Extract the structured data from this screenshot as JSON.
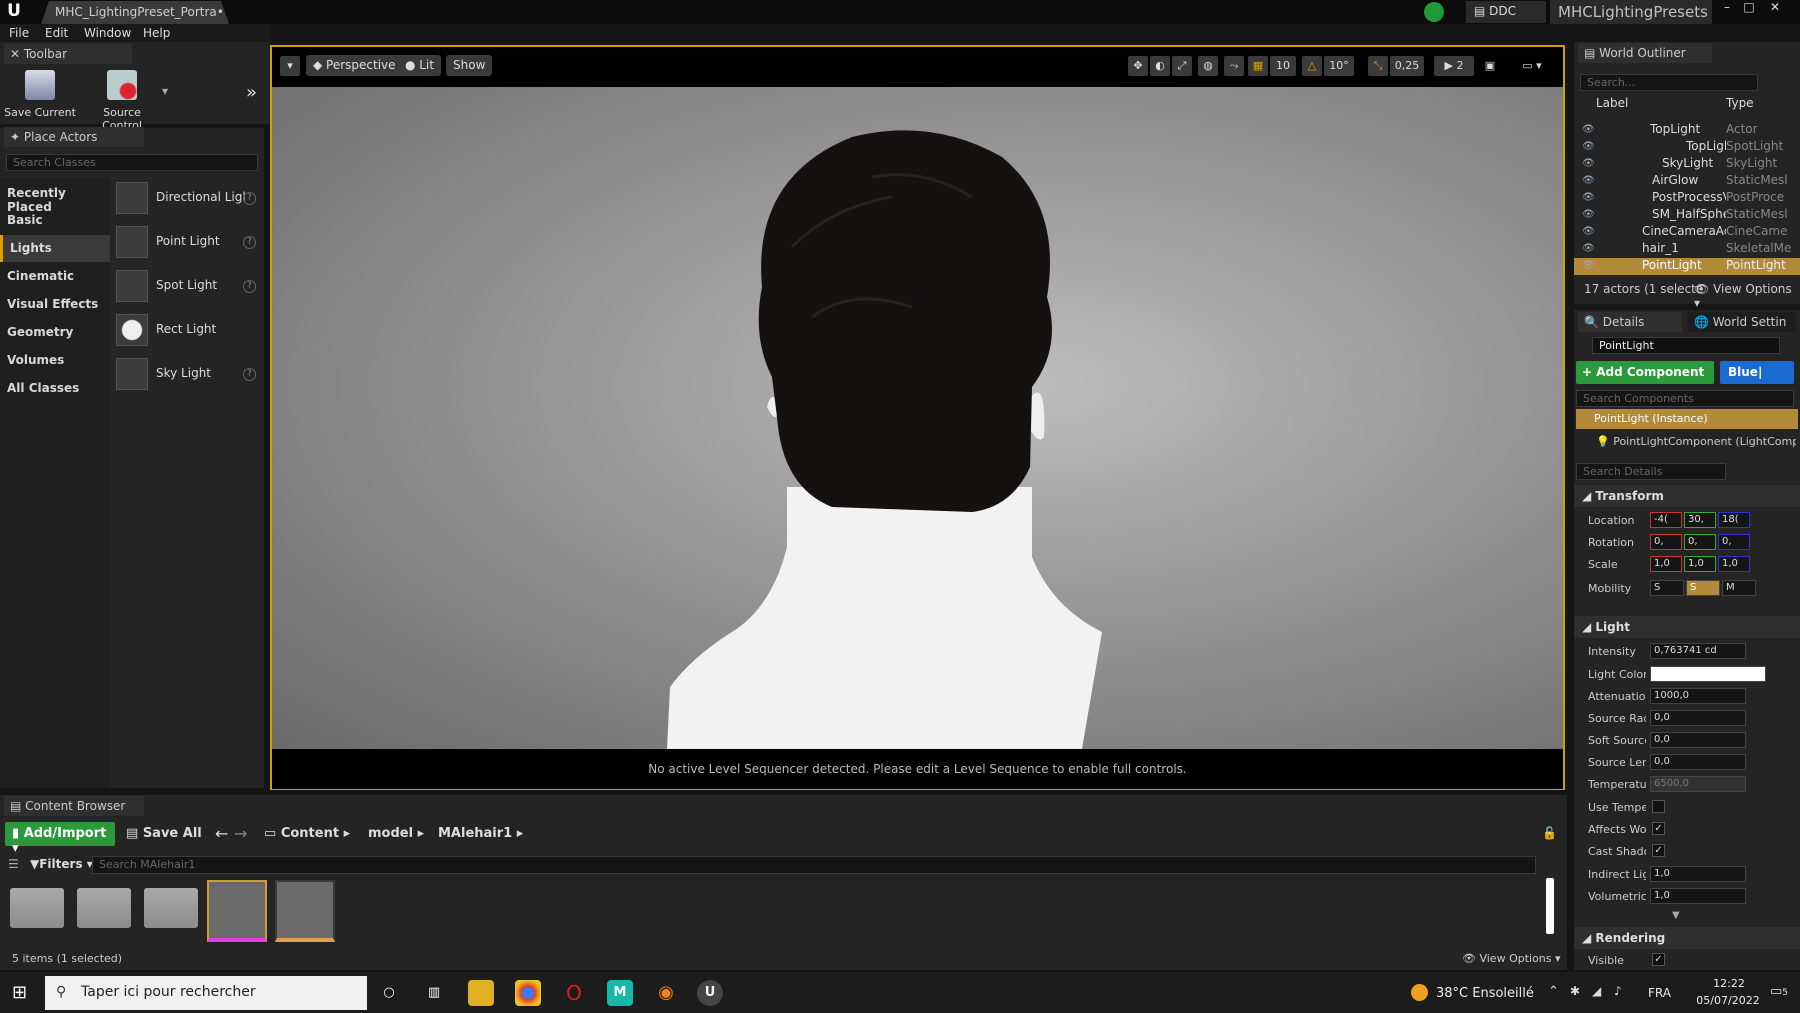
{
  "title_bar": {
    "doc_tab": "MHC_LightingPreset_Portra•",
    "ddc": "DDC",
    "project": "MHCLightingPresets",
    "window_buttons": [
      "–",
      "□",
      "✕"
    ]
  },
  "menu": [
    "File",
    "Edit",
    "Window",
    "Help"
  ],
  "toolbar": {
    "tab": "Toolbar",
    "save_current": "Save Current",
    "source_control": "Source Control"
  },
  "place_actors": {
    "tab": "Place Actors",
    "search_placeholder": "Search Classes",
    "categories": [
      "Recently Placed",
      "Basic",
      "Lights",
      "Cinematic",
      "Visual Effects",
      "Geometry",
      "Volumes",
      "All Classes"
    ],
    "active_category": "Lights",
    "items": [
      "Directional Ligl",
      "Point Light",
      "Spot Light",
      "Rect Light",
      "Sky Light"
    ]
  },
  "viewport": {
    "perspective": "Perspective",
    "lit": "Lit",
    "show": "Show",
    "grid_snap": "10",
    "rot_snap": "10°",
    "scale_snap": "0,25",
    "cam_speed": "2",
    "status": "No active Level Sequencer detected. Please edit a Level Sequence to enable full controls."
  },
  "outliner": {
    "tab": "World Outliner",
    "search_placeholder": "Search...",
    "col_label": "Label",
    "col_type": "Type",
    "rows": [
      {
        "label": "TopLight",
        "type": "Actor",
        "indent": 1
      },
      {
        "label": "TopLigl",
        "type": "SpotLight",
        "indent": 2
      },
      {
        "label": "SkyLight",
        "type": "SkyLight",
        "indent": 1
      },
      {
        "label": "AirGlow",
        "type": "StaticMesl",
        "indent": 0
      },
      {
        "label": "PostProcessV",
        "type": "PostProce",
        "indent": 0
      },
      {
        "label": "SM_HalfSpher",
        "type": "StaticMesl",
        "indent": 0
      },
      {
        "label": "CineCameraActc",
        "type": "CineCame",
        "indent": 0
      },
      {
        "label": "hair_1",
        "type": "SkeletalMe",
        "indent": 0
      },
      {
        "label": "PointLight",
        "type": "PointLight",
        "indent": 0
      }
    ],
    "footer": "17 actors (1 selecte",
    "view_options": "View Options"
  },
  "details": {
    "tab": "Details",
    "tab2": "World Settin",
    "name": "PointLight",
    "add_component": "+ Add Component",
    "blueprint": "Blue|",
    "search_components": "Search Components",
    "instance": "PointLight (Instance)",
    "component": "PointLightComponent (LightCompor",
    "search_details": "Search Details",
    "transform": {
      "title": "Transform",
      "location_label": "Location",
      "location": [
        "-4(",
        "30,",
        "18("
      ],
      "rotation_label": "Rotation",
      "rotation": [
        "0,",
        "0,",
        "0,"
      ],
      "scale_label": "Scale",
      "scale": [
        "1,0",
        "1,0",
        "1,0"
      ],
      "mobility_label": "Mobility",
      "mobility": [
        "S",
        "S",
        "M"
      ]
    },
    "light": {
      "title": "Light",
      "intensity_label": "Intensity",
      "intensity": "0,763741 cd",
      "color_label": "Light Color",
      "attenuation_label": "Attenuation",
      "attenuation": "1000,0",
      "source_radius_label": "Source Radi",
      "source_radius": "0,0",
      "soft_source_label": "Soft Source",
      "soft_source": "0,0",
      "source_length_label": "Source Leng",
      "source_length": "0,0",
      "temperature_label": "Temperatur",
      "temperature": "6500,0",
      "use_temp_label": "Use Temper",
      "affects_world_label": "Affects Worl",
      "cast_shadows_label": "Cast Shadov",
      "indirect_label": "Indirect Ligh",
      "indirect": "1,0",
      "volumetric_label": "Volumetric S",
      "volumetric": "1,0"
    },
    "rendering": {
      "title": "Rendering",
      "visible_label": "Visible"
    }
  },
  "content_browser": {
    "tab": "Content Browser",
    "add_import": "Add/Import",
    "save_all": "Save All",
    "path": [
      "Content",
      "model",
      "MAlehair1"
    ],
    "filters": "Filters",
    "search_placeholder": "Search MAlehair1",
    "status": "5 items (1 selected)",
    "view_options": "View Options"
  },
  "taskbar": {
    "search": "Taper ici pour rechercher",
    "weather": "38°C  Ensoleillé",
    "lang": "FRA",
    "time": "12:22",
    "date": "05/07/2022",
    "notifications": "5"
  },
  "colors": {
    "accent": "#d2a000",
    "green": "#2c9a3c",
    "blue": "#1a6ad0",
    "selection": "#b38a3a"
  }
}
